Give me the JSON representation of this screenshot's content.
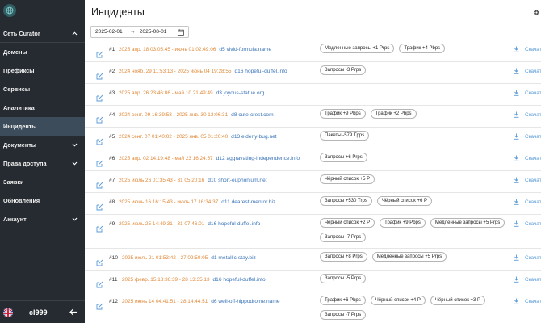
{
  "sidebar": {
    "logo": "globe-logo-icon",
    "items": [
      {
        "label": "Сеть Curator",
        "chevron": "up",
        "section": true
      },
      {
        "label": "Домены"
      },
      {
        "label": "Префиксы"
      },
      {
        "label": "Сервисы"
      },
      {
        "label": "Аналитика"
      },
      {
        "label": "Инциденты",
        "active": true
      },
      {
        "label": "Документы",
        "chevron": "down"
      },
      {
        "label": "Права доступа",
        "chevron": "down"
      },
      {
        "label": "Заявки"
      },
      {
        "label": "Обновления"
      },
      {
        "label": "Аккаунт",
        "chevron": "down"
      }
    ],
    "footer": {
      "user": "cl999",
      "flag": "uk-flag-icon",
      "back": "arrow-left-icon"
    }
  },
  "header": {
    "title": "Инциденты",
    "settings_icon": "gear-icon"
  },
  "filter": {
    "date_from": "2025-02-01",
    "arrow": "→",
    "date_to": "2025-08-01",
    "calendar_icon": "calendar-icon"
  },
  "colors": {
    "sidebar_bg": "#262b31",
    "active_bg": "#3d4c5a",
    "date_orange": "#e08a3a",
    "link_blue": "#3a74b8",
    "download_blue": "#5a9bd8"
  },
  "download_label": "Скачать",
  "incidents": [
    {
      "num": "#1",
      "dates": "2025 апр. 18 03:05:45 - июнь 01 02:49:06",
      "domain": "d5 vivid-formula.name",
      "tags": [
        "Медленные запросы +1 Prps",
        "Трафик +4 Pbps"
      ]
    },
    {
      "num": "#2",
      "dates": "2024 нояб. 29 11:53:13 - 2025 июнь 04 19:28:55",
      "domain": "d16 hopeful-duffel.info",
      "tags": [
        "Запросы -3 Prps"
      ]
    },
    {
      "num": "#3",
      "dates": "2025 апр. 26 23:46:06 - май 10 21:49:49",
      "domain": "d3 joyous-statue.org",
      "tags": []
    },
    {
      "num": "#4",
      "dates": "2024 сент. 09 16:39:58 - 2025 янв. 30 13:06:31",
      "domain": "d8 cute-crest.com",
      "tags": [
        "Трафик +9 Pbps",
        "Трафик +2 Pbps"
      ]
    },
    {
      "num": "#5",
      "dates": "2024 сент. 07 01:40:02 - 2025 янв. 05 01:20:40",
      "domain": "d13 elderly-bug.net",
      "tags": [
        "Пакеты -579 Tpps"
      ]
    },
    {
      "num": "#6",
      "dates": "2025 апр. 02 14:19:48 - май 23 16:24:57",
      "domain": "d12 aggravating-independence.info",
      "tags": [
        "Запросы +6 Prps"
      ]
    },
    {
      "num": "#7",
      "dates": "2025 июль 26 01:35:43 - 31 05:20:16",
      "domain": "d10 short-euphonium.net",
      "tags": [
        "Чёрный список +5 P"
      ]
    },
    {
      "num": "#8",
      "dates": "2025 июнь 16 16:15:43 - июль 17 16:34:37",
      "domain": "d11 dearest-mentor.biz",
      "tags": [
        "Запросы +530 Trps",
        "Чёрный список +6 P"
      ]
    },
    {
      "num": "#9",
      "dates": "2025 июль 25 14:49:31 - 31 07:46:01",
      "domain": "d16 hopeful-duffel.info",
      "tags": [
        "Чёрный список +2 P",
        "Трафик +9 Pbps",
        "Медленные запросы +5 Prps",
        "Запросы -7 Prps"
      ]
    },
    {
      "num": "#10",
      "dates": "2025 июль 21 01:53:42 - 27 02:50:05",
      "domain": "d1 metallic-stay.biz",
      "tags": [
        "Запросы +8 Prps",
        "Медленные запросы +5 Prps"
      ]
    },
    {
      "num": "#11",
      "dates": "2025 февр. 15 18:36:39 - 28 13:35:13",
      "domain": "d16 hopeful-duffel.info",
      "tags": [
        "Запросы -5 Prps"
      ]
    },
    {
      "num": "#12",
      "dates": "2025 июнь 14 04:41:51 - 28 14:44:51",
      "domain": "d6 well-off-hippodrome.name",
      "tags": [
        "Трафик +6 Pbps",
        "Чёрный список +4 P",
        "Чёрный список +3 P",
        "Запросы -7 Prps"
      ]
    }
  ]
}
